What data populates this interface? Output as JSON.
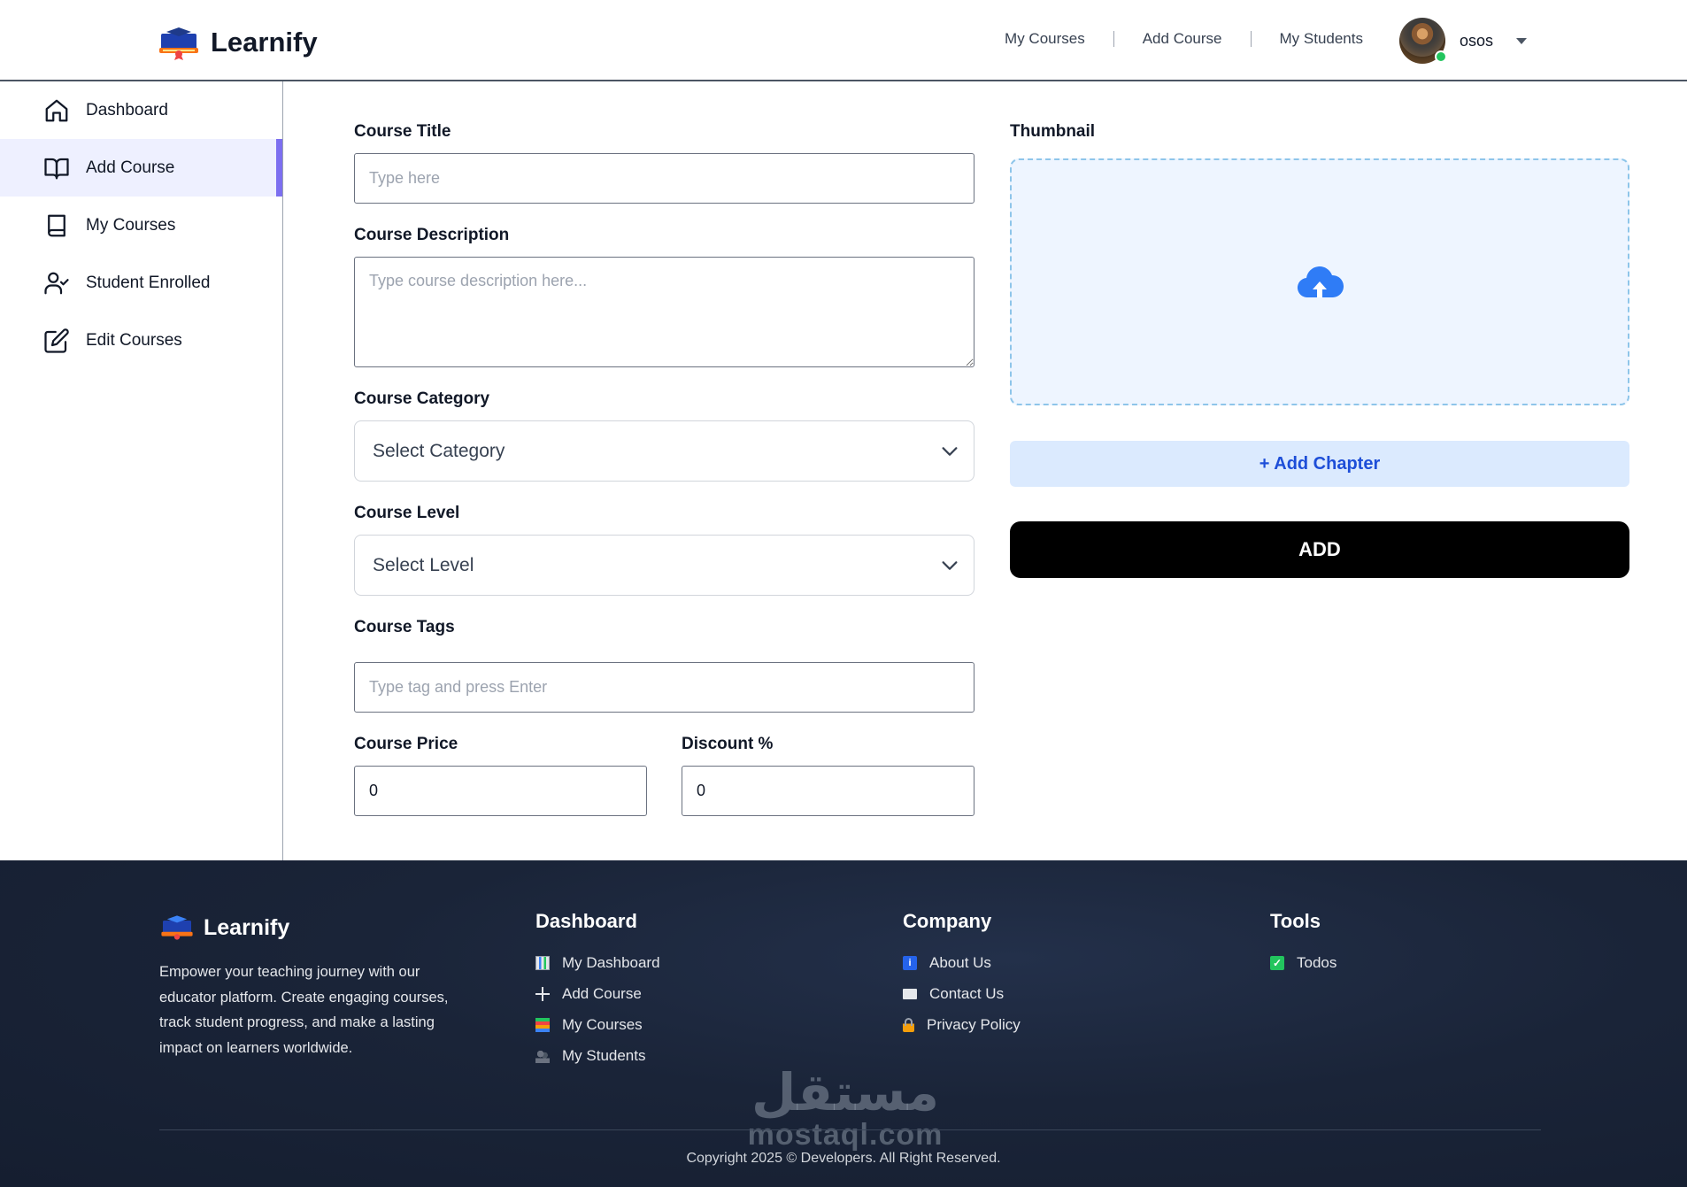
{
  "header": {
    "brand": "Learnify",
    "nav": [
      "My Courses",
      "Add Course",
      "My Students"
    ],
    "user_name": "osos"
  },
  "sidebar": {
    "items": [
      {
        "label": "Dashboard",
        "icon": "home-icon",
        "active": false
      },
      {
        "label": "Add Course",
        "icon": "book-open-icon",
        "active": true
      },
      {
        "label": "My Courses",
        "icon": "book-icon",
        "active": false
      },
      {
        "label": "Student Enrolled",
        "icon": "user-check-icon",
        "active": false
      },
      {
        "label": "Edit Courses",
        "icon": "edit-icon",
        "active": false
      }
    ]
  },
  "form": {
    "title_label": "Course Title",
    "title_placeholder": "Type here",
    "description_label": "Course Description",
    "description_placeholder": "Type course description here...",
    "category_label": "Course Category",
    "category_value": "Select Category",
    "level_label": "Course Level",
    "level_value": "Select Level",
    "tags_label": "Course Tags",
    "tags_placeholder": "Type tag and press Enter",
    "price_label": "Course Price",
    "price_value": "0",
    "discount_label": "Discount %",
    "discount_value": "0",
    "thumbnail_label": "Thumbnail",
    "add_chapter_label": "+ Add Chapter",
    "add_label": "ADD"
  },
  "footer": {
    "brand": "Learnify",
    "description": "Empower your teaching journey with our educator platform. Create engaging courses, track student progress, and make a lasting impact on learners worldwide.",
    "dashboard": {
      "title": "Dashboard",
      "links": [
        "My Dashboard",
        "Add Course",
        "My Courses",
        "My Students"
      ]
    },
    "company": {
      "title": "Company",
      "links": [
        "About Us",
        "Contact Us",
        "Privacy Policy"
      ]
    },
    "tools": {
      "title": "Tools",
      "links": [
        "Todos"
      ]
    },
    "copyright": "Copyright 2025 © Developers. All Right Reserved.",
    "watermark_ar": "مستقل",
    "watermark_latin": "mostaql.com"
  },
  "colors": {
    "accent": "#7c6ff0",
    "primary_button": "#000000",
    "chapter_button_bg": "#dbeafe",
    "chapter_button_text": "#1d4ed8",
    "footer_bg": "#1a2438",
    "online": "#22c55e"
  }
}
